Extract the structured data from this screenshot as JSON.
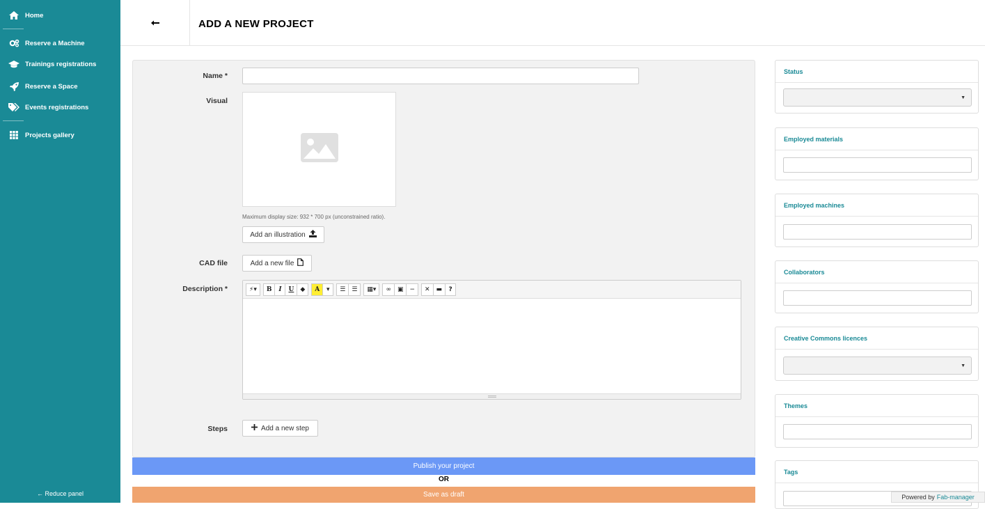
{
  "sidebar": {
    "items": [
      {
        "label": "Home",
        "icon": "home-icon"
      },
      {
        "label": "Reserve a Machine",
        "icon": "cogs-icon"
      },
      {
        "label": "Trainings registrations",
        "icon": "graduation-cap-icon"
      },
      {
        "label": "Reserve a Space",
        "icon": "rocket-icon"
      },
      {
        "label": "Events registrations",
        "icon": "tags-icon"
      },
      {
        "label": "Projects gallery",
        "icon": "grid-icon"
      }
    ],
    "reduce_label": "← Reduce panel"
  },
  "header": {
    "back_icon": "arrow-left-icon",
    "title": "ADD A NEW PROJECT"
  },
  "form": {
    "name_label": "Name *",
    "name_value": "",
    "visual_label": "Visual",
    "visual_hint": "Maximum display size: 932 * 700 px (unconstrained ratio).",
    "add_illustration_label": "Add an illustration",
    "cad_label": "CAD file",
    "add_file_label": "Add a new file",
    "description_label": "Description *",
    "toolbar": [
      "magic",
      "B",
      "I",
      "U",
      "eraser",
      "A",
      "ul",
      "ol",
      "table",
      "link",
      "picture",
      "hr",
      "fullscreen",
      "code",
      "?"
    ],
    "steps_label": "Steps",
    "add_step_label": "Add a new step"
  },
  "actions": {
    "publish_label": "Publish your project",
    "or_label": "OR",
    "draft_label": "Save as draft"
  },
  "widgets": {
    "status": {
      "title": "Status",
      "value": ""
    },
    "materials": {
      "title": "Employed materials",
      "value": ""
    },
    "machines": {
      "title": "Employed machines",
      "value": ""
    },
    "collaborators": {
      "title": "Collaborators",
      "value": ""
    },
    "licences": {
      "title": "Creative Commons licences",
      "value": ""
    },
    "themes": {
      "title": "Themes",
      "value": ""
    },
    "tags": {
      "title": "Tags",
      "value": ""
    }
  },
  "footer": {
    "powered_prefix": "Powered by",
    "powered_link": "Fab-manager"
  },
  "colors": {
    "sidebar": "#1a8a96",
    "accent": "#1a8a96",
    "publish": "#6b98f6",
    "draft": "#f0a46f"
  }
}
